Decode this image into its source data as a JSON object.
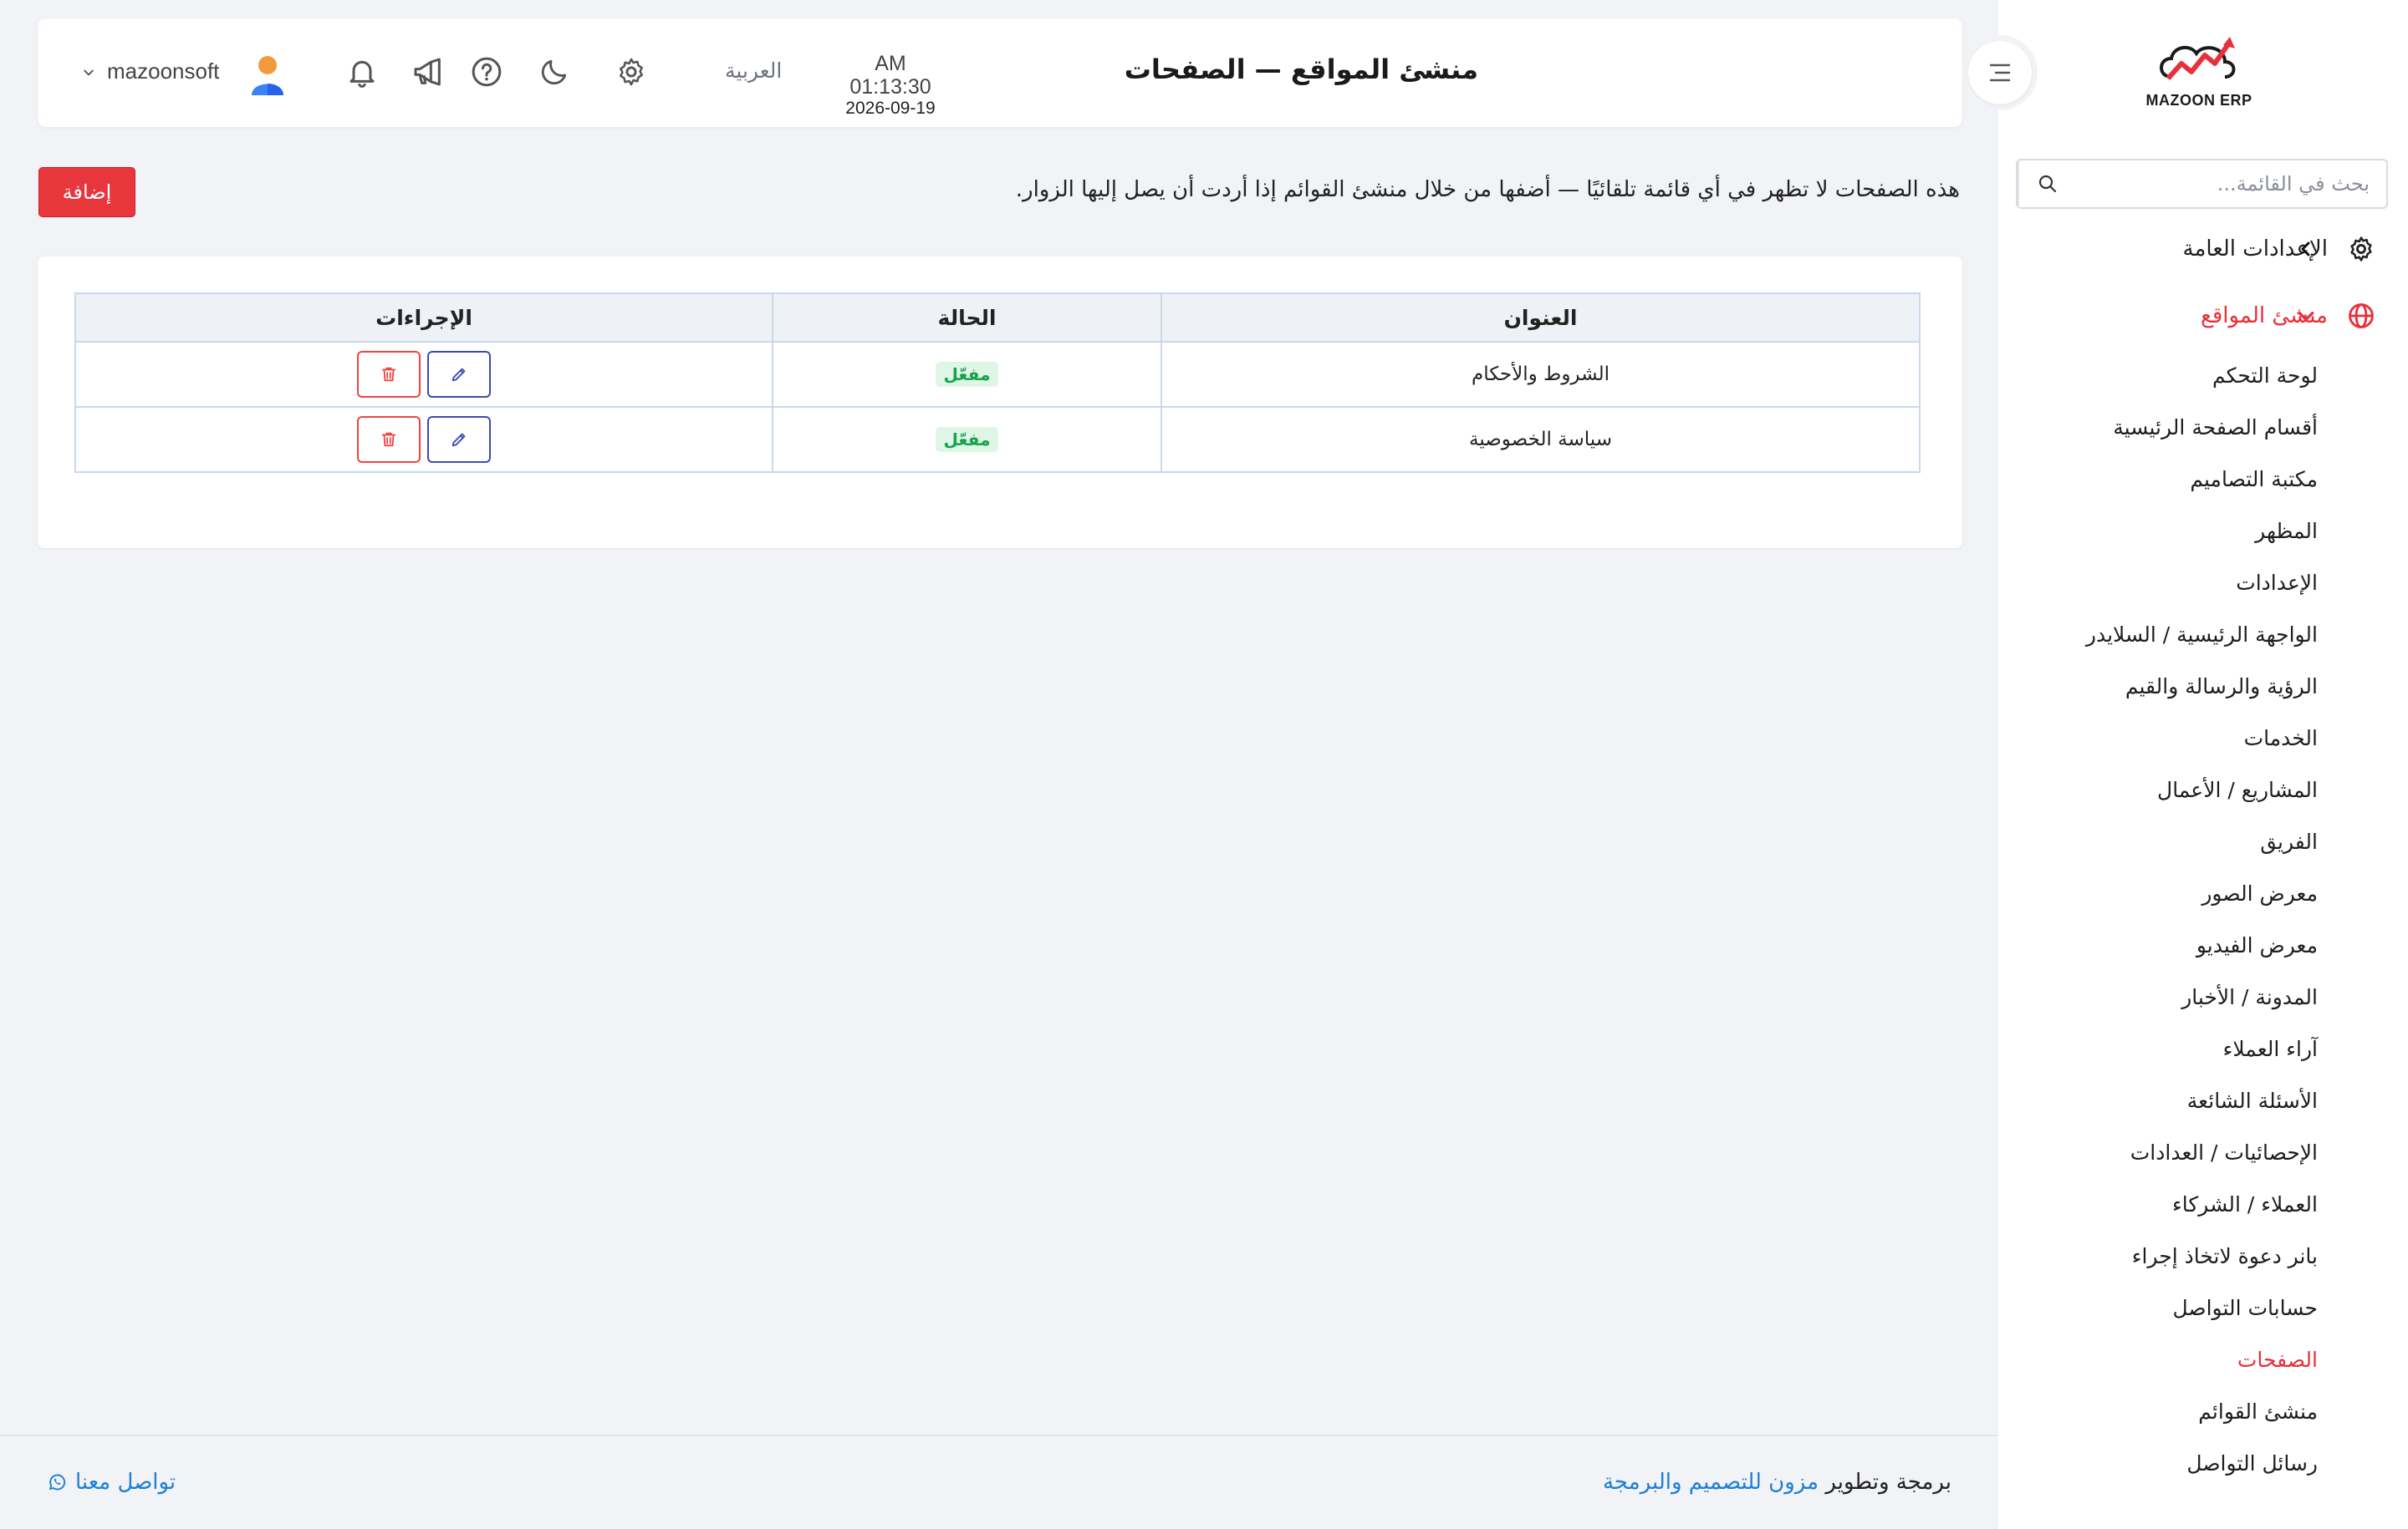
{
  "brand": {
    "logo_text": "MAZOON ERP",
    "accent_color": "#e8303a"
  },
  "sidebar": {
    "search_placeholder": "بحث في القائمة...",
    "groups": [
      {
        "label": "الإعدادات العامة",
        "icon": "gear-icon",
        "expanded": false
      },
      {
        "label": "منشئ المواقع",
        "icon": "globe-icon",
        "expanded": true
      }
    ],
    "items": [
      {
        "label": "لوحة التحكم"
      },
      {
        "label": "أقسام الصفحة الرئيسية"
      },
      {
        "label": "مكتبة التصاميم"
      },
      {
        "label": "المظهر"
      },
      {
        "label": "الإعدادات"
      },
      {
        "label": "الواجهة الرئيسية / السلايدر"
      },
      {
        "label": "الرؤية والرسالة والقيم"
      },
      {
        "label": "الخدمات"
      },
      {
        "label": "المشاريع / الأعمال"
      },
      {
        "label": "الفريق"
      },
      {
        "label": "معرض الصور"
      },
      {
        "label": "معرض الفيديو"
      },
      {
        "label": "المدونة / الأخبار"
      },
      {
        "label": "آراء العملاء"
      },
      {
        "label": "الأسئلة الشائعة"
      },
      {
        "label": "الإحصائيات / العدادات"
      },
      {
        "label": "العملاء / الشركاء"
      },
      {
        "label": "بانر دعوة لاتخاذ إجراء"
      },
      {
        "label": "حسابات التواصل"
      },
      {
        "label": "الصفحات",
        "active": true
      },
      {
        "label": "منشئ القوائم"
      },
      {
        "label": "رسائل التواصل"
      }
    ]
  },
  "header": {
    "title": "منشئ المواقع — الصفحات",
    "time": "AM 01:13:30",
    "date": "2026-09-19",
    "language": "العربية",
    "username": "mazoonsoft"
  },
  "main": {
    "info_text": "هذه الصفحات لا تظهر في أي قائمة تلقائيًا — أضفها من خلال منشئ القوائم إذا أردت أن يصل إليها الزوار.",
    "add_label": "إضافة",
    "table": {
      "headers": {
        "title": "العنوان",
        "status": "الحالة",
        "actions": "الإجراءات"
      },
      "rows": [
        {
          "title": "الشروط والأحكام",
          "status": "مفعّل"
        },
        {
          "title": "سياسة الخصوصية",
          "status": "مفعّل"
        }
      ]
    }
  },
  "footer": {
    "credit_prefix": "برمجة وتطوير",
    "credit_link": "مزون للتصميم والبرمجة",
    "contact_label": "تواصل معنا"
  }
}
